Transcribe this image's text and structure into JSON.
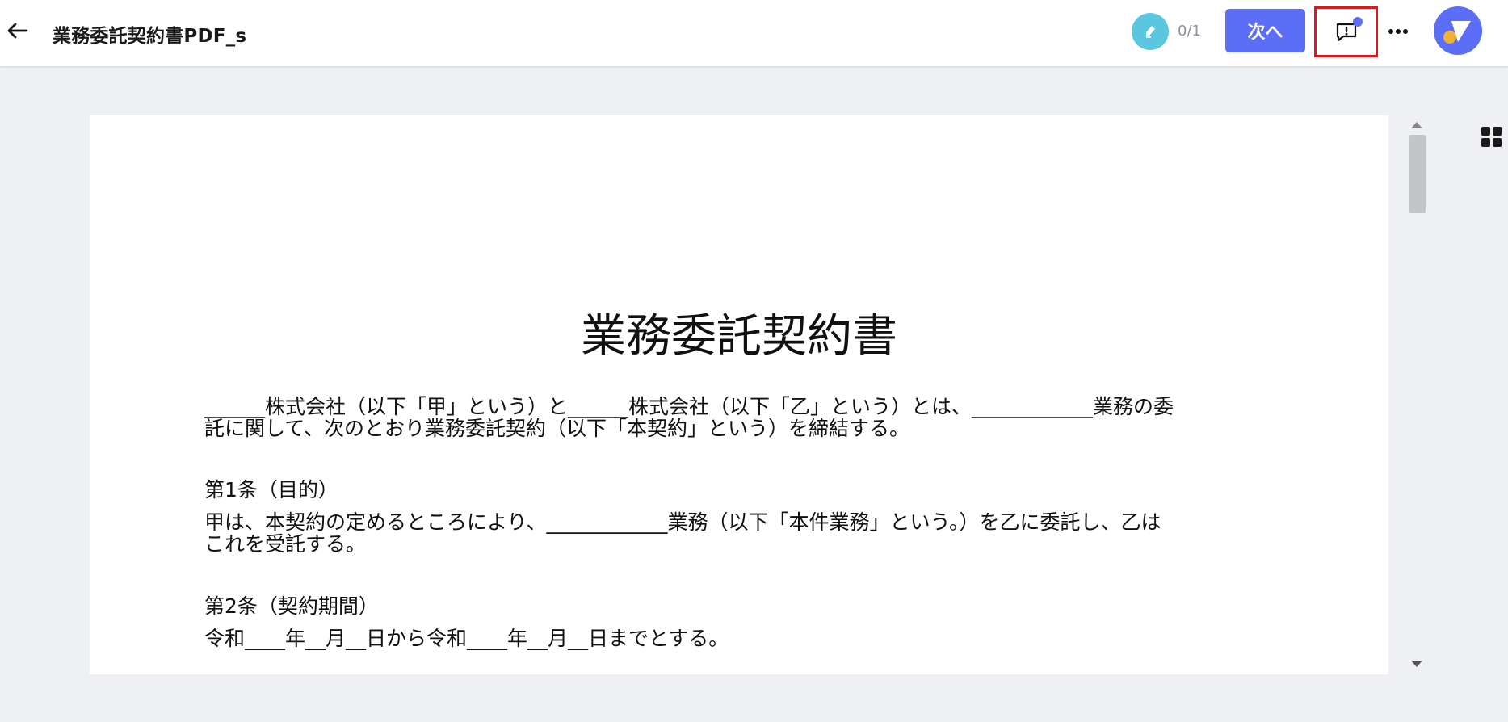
{
  "header": {
    "title": "業務委託契約書PDF_s",
    "signature_count": "0/1",
    "next_label": "次へ"
  },
  "document": {
    "heading": "業務委託契約書",
    "intro_lines": [
      "______株式会社（以下「甲」という）と______株式会社（以下「乙」という）とは、____________業務の委",
      "託に関して、次のとおり業務委託契約（以下「本契約」という）を締結する。"
    ],
    "article1_title": "第1条（目的）",
    "article1_lines": [
      "甲は、本契約の定めるところにより、____________業務（以下「本件業務」という。）を乙に委託し、乙は",
      "これを受託する。"
    ],
    "article2_title": "第2条（契約期間）",
    "article2_lines": [
      "令和____年__月__日から令和____年__月__日までとする。"
    ]
  },
  "colors": {
    "accent": "#5b6ef5",
    "signature_badge": "#5bc6e0",
    "highlight_border": "#e0161e",
    "avatar_dot": "#f2b233",
    "background": "#eef0f3"
  },
  "icons": {
    "back": "arrow-left-icon",
    "signature": "pen-icon",
    "comment": "comment-alert-icon",
    "more": "more-horizontal-icon",
    "grid": "grid-view-icon"
  }
}
